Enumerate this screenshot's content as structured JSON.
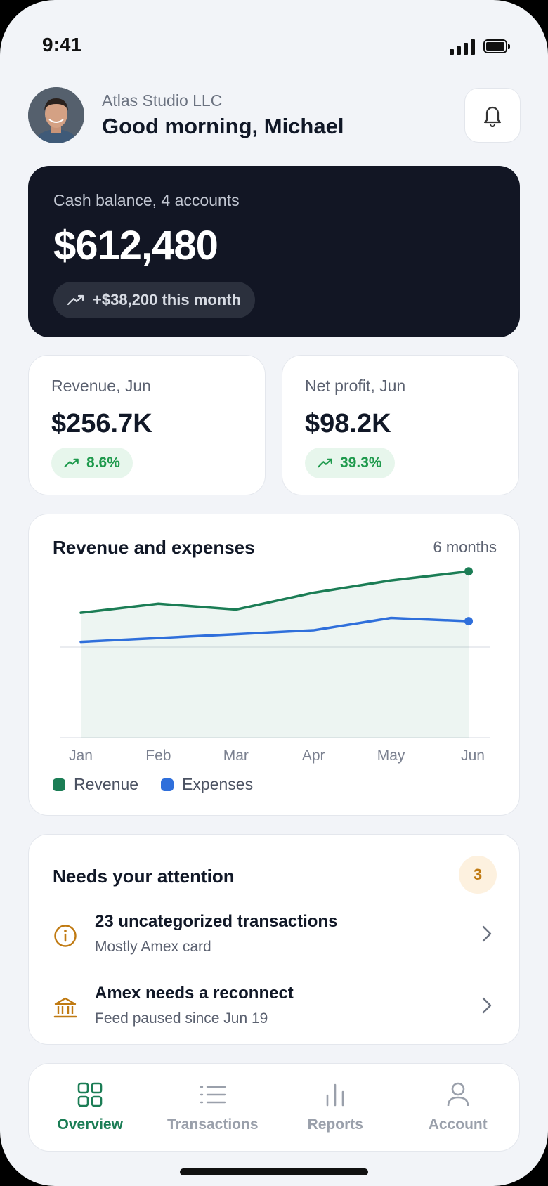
{
  "status_bar": {
    "time": "9:41"
  },
  "header": {
    "company": "Atlas Studio LLC",
    "greeting": "Good morning, Michael",
    "avatar": "avatar"
  },
  "balance": {
    "label": "Cash balance, 4 accounts",
    "value": "$612,480",
    "change": "+$38,200 this month"
  },
  "kpis": [
    {
      "label": "Revenue, Jun",
      "value": "$256.7K",
      "change": "8.6%"
    },
    {
      "label": "Net profit, Jun",
      "value": "$98.2K",
      "change": "39.3%"
    }
  ],
  "chart_card": {
    "title": "Revenue and expenses",
    "range": "6 months"
  },
  "chart_data": {
    "type": "line",
    "x": [
      "Jan",
      "Feb",
      "Mar",
      "Apr",
      "May",
      "Jun"
    ],
    "series": [
      {
        "name": "Revenue",
        "color": "#1b7d55",
        "values": [
          193,
          207,
          198,
          224,
          243,
          257
        ]
      },
      {
        "name": "Expenses",
        "color": "#2f6fdb",
        "values": [
          148,
          154,
          160,
          166,
          185,
          180
        ]
      }
    ],
    "ylim": [
      0,
      280
    ],
    "grid": true,
    "legend": "bottom-left"
  },
  "attention": {
    "title": "Needs your attention",
    "count": "3",
    "items": [
      {
        "title": "23 uncategorized transactions",
        "subtitle": "Mostly Amex card",
        "icon": "info-icon"
      },
      {
        "title": "Amex needs a reconnect",
        "subtitle": "Feed paused since Jun 19",
        "icon": "bank-icon"
      }
    ]
  },
  "tabs": [
    {
      "label": "Overview",
      "icon": "grid-icon",
      "active": true
    },
    {
      "label": "Transactions",
      "icon": "list-icon",
      "active": false
    },
    {
      "label": "Reports",
      "icon": "bar-chart-icon",
      "active": false
    },
    {
      "label": "Account",
      "icon": "user-icon",
      "active": false
    }
  ],
  "colors": {
    "accent": "#1b7d55",
    "positive": "#1f9a4d",
    "warning": "#c07a12",
    "dark_card": "#121624"
  }
}
